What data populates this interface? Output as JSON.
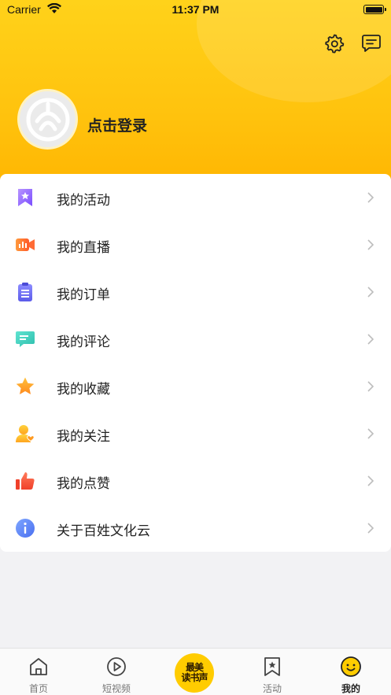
{
  "status_bar": {
    "carrier": "Carrier",
    "time": "11:37 PM"
  },
  "header": {
    "login_label": "点击登录"
  },
  "menu": [
    {
      "label": "我的活动",
      "icon": "bookmark-star-icon"
    },
    {
      "label": "我的直播",
      "icon": "video-camera-icon"
    },
    {
      "label": "我的订单",
      "icon": "clipboard-icon"
    },
    {
      "label": "我的评论",
      "icon": "comment-icon"
    },
    {
      "label": "我的收藏",
      "icon": "star-icon"
    },
    {
      "label": "我的关注",
      "icon": "user-heart-icon"
    },
    {
      "label": "我的点赞",
      "icon": "thumbs-up-icon"
    },
    {
      "label": "关于百姓文化云",
      "icon": "info-icon"
    }
  ],
  "tabs": [
    {
      "label": "首页",
      "icon": "home-icon"
    },
    {
      "label": "短视频",
      "icon": "play-icon"
    },
    {
      "label": "",
      "icon": "logo"
    },
    {
      "label": "活动",
      "icon": "bookmark-star-icon"
    },
    {
      "label": "我的",
      "icon": "smile-icon"
    }
  ],
  "center_logo": {
    "line1": "最美",
    "line2": "读书声"
  },
  "colors": {
    "accent": "#ffc20d",
    "background": "#f2f2f4"
  }
}
